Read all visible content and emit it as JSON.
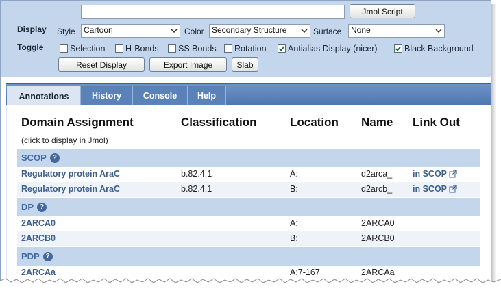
{
  "controls": {
    "script_input_value": "",
    "jmol_script_label": "Jmol Script",
    "display_label": "Display",
    "toggle_label": "Toggle",
    "style_label": "Style",
    "style_value": "Cartoon",
    "color_label": "Color",
    "color_value": "Secondary Structure",
    "surface_label": "Surface",
    "surface_value": "None",
    "toggles": [
      {
        "label": "Selection",
        "checked": false
      },
      {
        "label": "H-Bonds",
        "checked": false
      },
      {
        "label": "SS Bonds",
        "checked": false
      },
      {
        "label": "Rotation",
        "checked": false
      },
      {
        "label": "Antialias Display (nicer)",
        "checked": true
      },
      {
        "label": "Black Background",
        "checked": true
      }
    ],
    "reset_label": "Reset Display",
    "export_label": "Export Image",
    "slab_label": "Slab"
  },
  "tabs": [
    {
      "label": "Annotations",
      "active": true
    },
    {
      "label": "History",
      "active": false
    },
    {
      "label": "Console",
      "active": false
    },
    {
      "label": "Help",
      "active": false
    }
  ],
  "table": {
    "headers": {
      "domain": "Domain Assignment",
      "classification": "Classification",
      "location": "Location",
      "name": "Name",
      "link": "Link Out"
    },
    "note": "(click to display in Jmol)",
    "sections": [
      {
        "title": "SCOP",
        "rows": [
          {
            "domain": "Regulatory protein AraC",
            "classification": "b.82.4.1",
            "location": "A:",
            "name": "d2arca_",
            "link": "in SCOP"
          },
          {
            "domain": "Regulatory protein AraC",
            "classification": "b.82.4.1",
            "location": "B:",
            "name": "d2arcb_",
            "link": "in SCOP"
          }
        ]
      },
      {
        "title": "DP",
        "rows": [
          {
            "domain": "2ARCA0",
            "classification": "",
            "location": "A:",
            "name": "2ARCA0",
            "link": ""
          },
          {
            "domain": "2ARCB0",
            "classification": "",
            "location": "B:",
            "name": "2ARCB0",
            "link": ""
          }
        ]
      },
      {
        "title": "PDP",
        "rows": [
          {
            "domain": "2ARCAa",
            "classification": "",
            "location": "A:7-167",
            "name": "2ARCAa",
            "link": ""
          }
        ]
      }
    ]
  },
  "colors": {
    "panel_bg": "#c4d6ec",
    "tab_bar": "#5b82b8",
    "link": "#3c5f8e",
    "section_title": "#3f6aa2"
  },
  "icons": {
    "select_arrow": "chevron-down-icon",
    "help": "help-icon",
    "external_link": "external-link-icon",
    "checkmark": "checkmark-icon"
  }
}
